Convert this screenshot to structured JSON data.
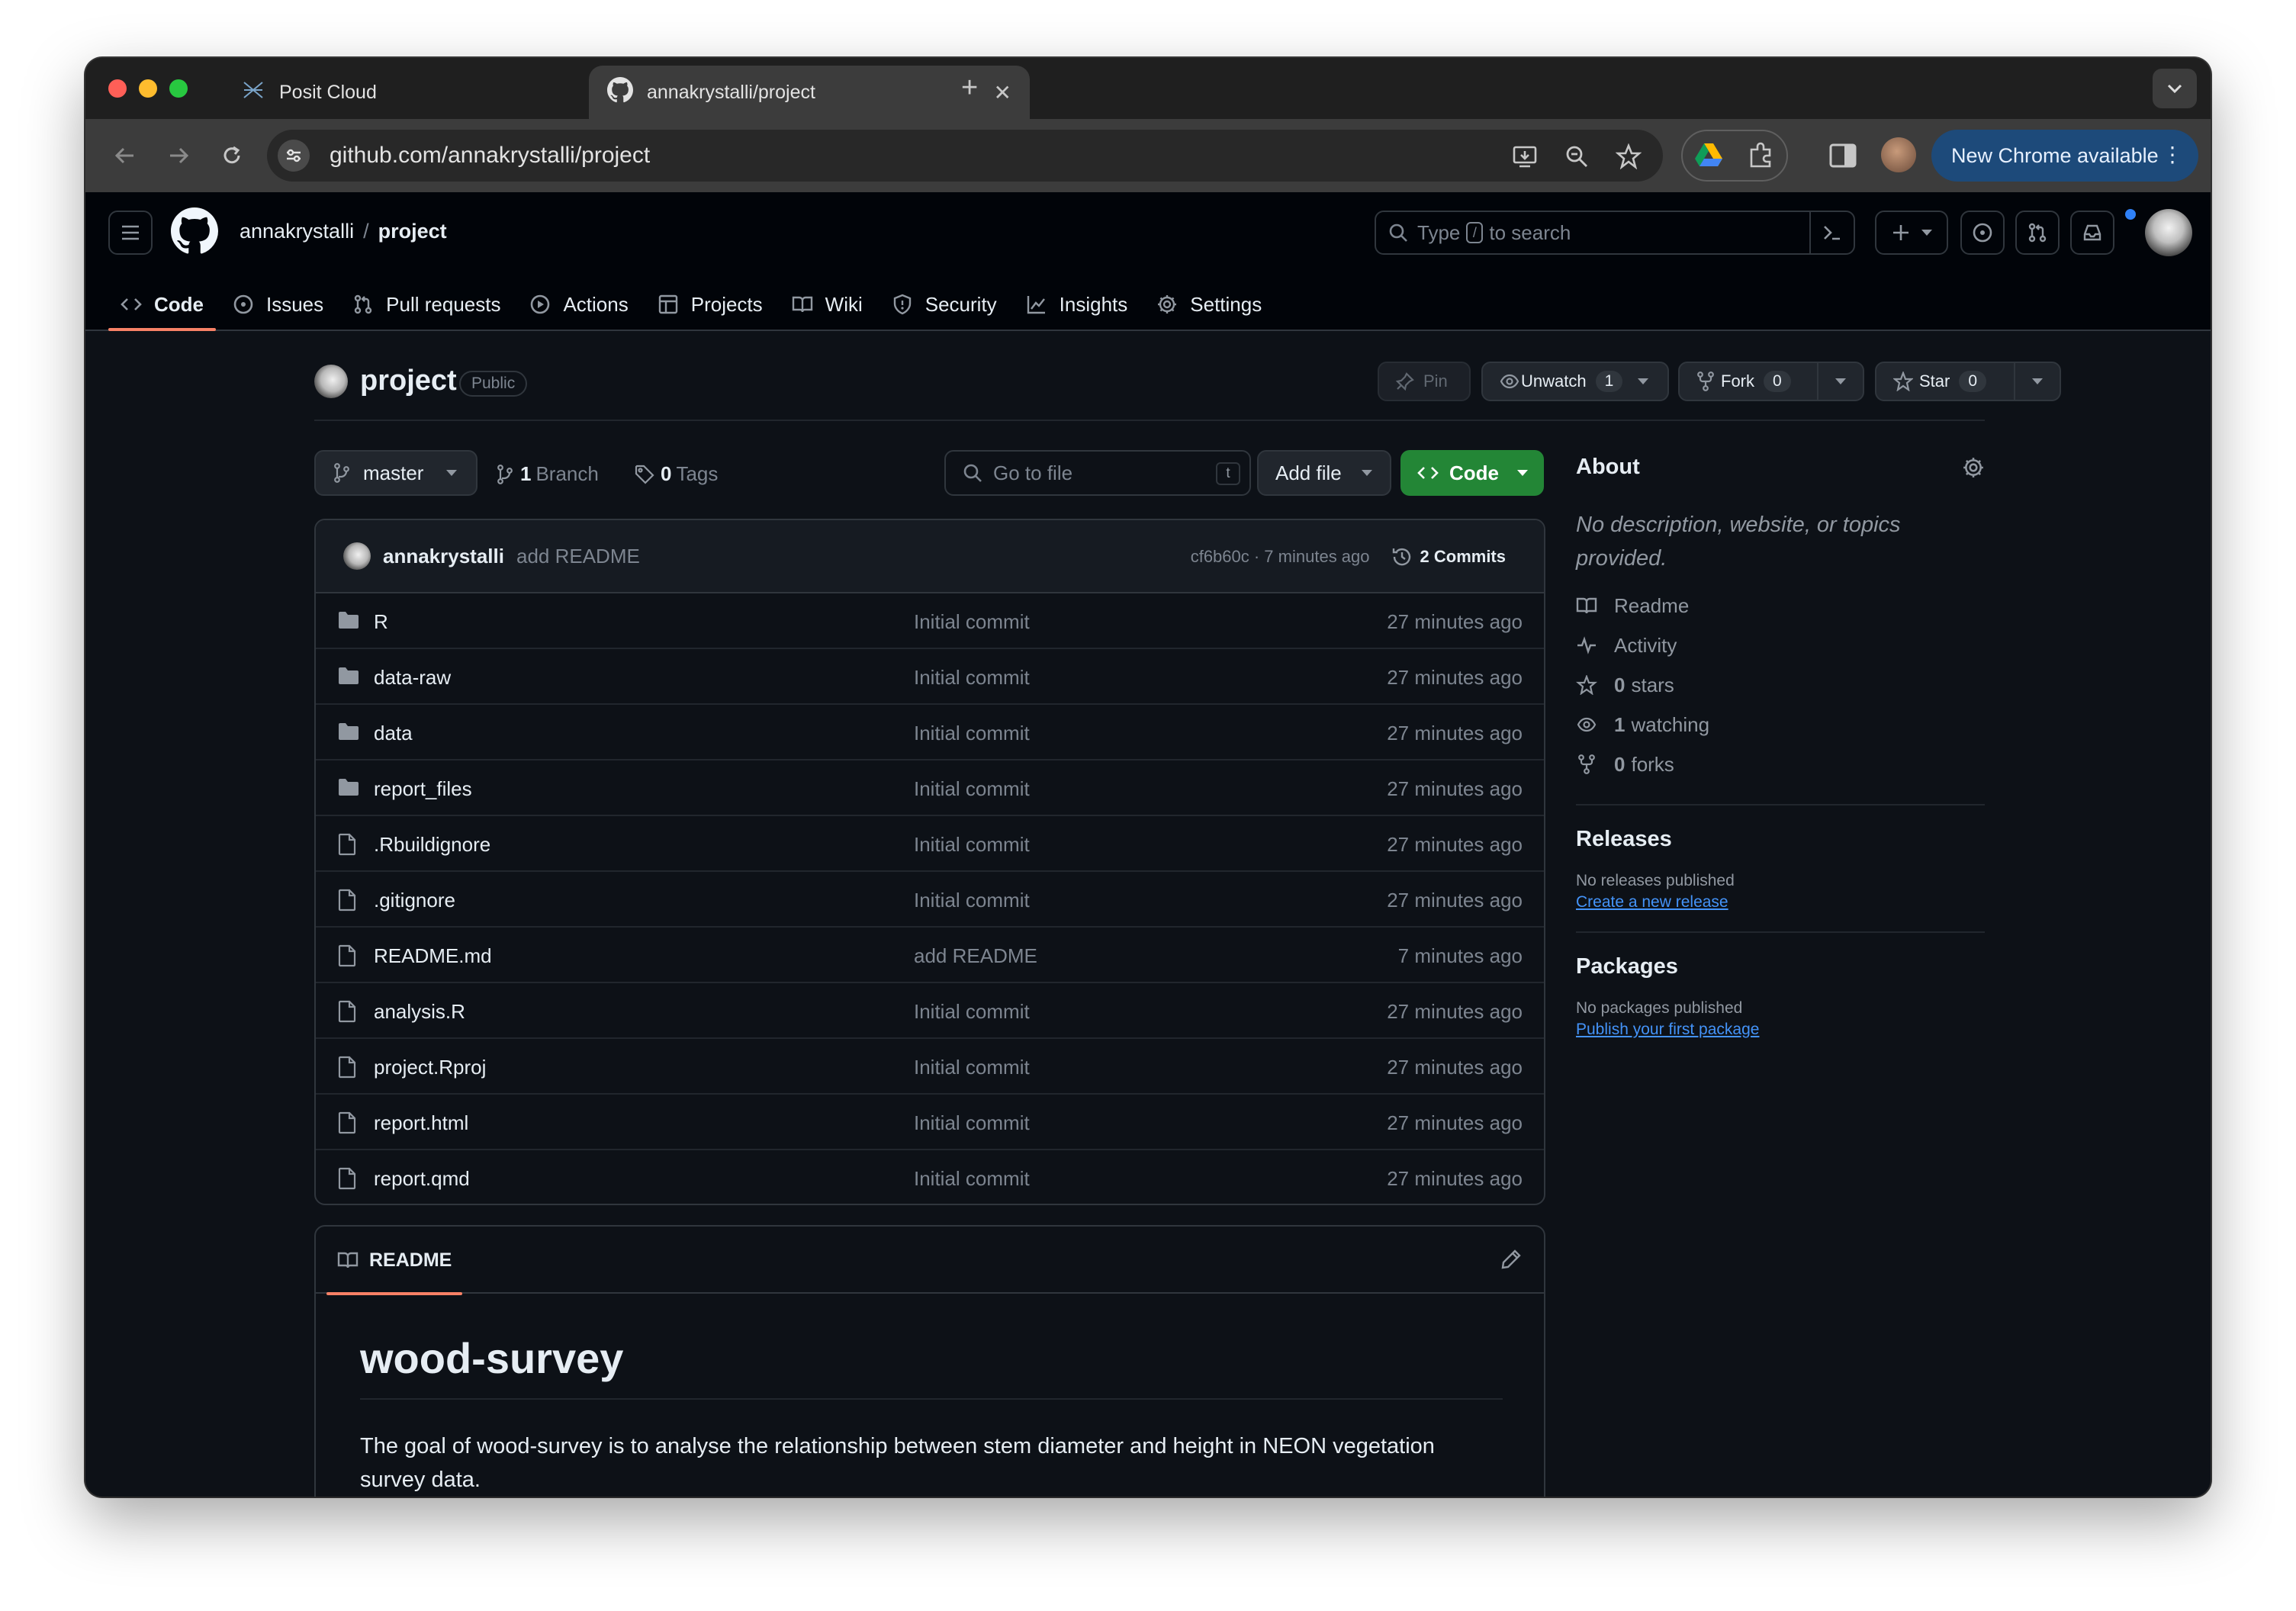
{
  "browser": {
    "tabs": [
      {
        "title": "Posit Cloud",
        "active": false
      },
      {
        "title": "annakrystalli/project",
        "active": true
      }
    ],
    "new_tab_symbol": "+",
    "url": "github.com/annakrystalli/project",
    "update_label": "New Chrome available",
    "traffic_colors": [
      "#ff5f57",
      "#febc2e",
      "#28c840"
    ]
  },
  "header": {
    "owner": "annakrystalli",
    "separator": "/",
    "repo": "project",
    "search": {
      "prefix": "Type",
      "key": "/",
      "suffix": "to search"
    }
  },
  "repo_nav": [
    {
      "label": "Code",
      "icon": "code-icon",
      "active": true
    },
    {
      "label": "Issues",
      "icon": "issue-icon",
      "active": false
    },
    {
      "label": "Pull requests",
      "icon": "pull-request-icon",
      "active": false
    },
    {
      "label": "Actions",
      "icon": "play-icon",
      "active": false
    },
    {
      "label": "Projects",
      "icon": "table-icon",
      "active": false
    },
    {
      "label": "Wiki",
      "icon": "book-icon",
      "active": false
    },
    {
      "label": "Security",
      "icon": "shield-icon",
      "active": false
    },
    {
      "label": "Insights",
      "icon": "graph-icon",
      "active": false
    },
    {
      "label": "Settings",
      "icon": "gear-icon",
      "active": false
    }
  ],
  "repo": {
    "name": "project",
    "visibility": "Public",
    "pin_label": "Pin",
    "unwatch_label": "Unwatch",
    "watch_count": "1",
    "fork_label": "Fork",
    "fork_count": "0",
    "star_label": "Star",
    "star_count": "0"
  },
  "branch": {
    "current": "master",
    "branch_count": "1",
    "branch_label": "Branch",
    "tag_count": "0",
    "tag_label": "Tags",
    "goto_placeholder": "Go to file",
    "goto_key": "t",
    "add_file_label": "Add file",
    "code_label": "Code"
  },
  "latest_commit": {
    "author": "annakrystalli",
    "message": "add README",
    "meta": "cf6b60c · 7 minutes ago",
    "commits_label": "2 Commits"
  },
  "files": [
    {
      "name": "R",
      "type": "folder",
      "commit": "Initial commit",
      "date": "27 minutes ago"
    },
    {
      "name": "data-raw",
      "type": "folder",
      "commit": "Initial commit",
      "date": "27 minutes ago"
    },
    {
      "name": "data",
      "type": "folder",
      "commit": "Initial commit",
      "date": "27 minutes ago"
    },
    {
      "name": "report_files",
      "type": "folder",
      "commit": "Initial commit",
      "date": "27 minutes ago"
    },
    {
      "name": ".Rbuildignore",
      "type": "file",
      "commit": "Initial commit",
      "date": "27 minutes ago"
    },
    {
      "name": ".gitignore",
      "type": "file",
      "commit": "Initial commit",
      "date": "27 minutes ago"
    },
    {
      "name": "README.md",
      "type": "file",
      "commit": "add README",
      "date": "7 minutes ago"
    },
    {
      "name": "analysis.R",
      "type": "file",
      "commit": "Initial commit",
      "date": "27 minutes ago"
    },
    {
      "name": "project.Rproj",
      "type": "file",
      "commit": "Initial commit",
      "date": "27 minutes ago"
    },
    {
      "name": "report.html",
      "type": "file",
      "commit": "Initial commit",
      "date": "27 minutes ago"
    },
    {
      "name": "report.qmd",
      "type": "file",
      "commit": "Initial commit",
      "date": "27 minutes ago"
    }
  ],
  "readme": {
    "tab_label": "README",
    "heading": "wood-survey",
    "paragraph": "The goal of wood-survey is to analyse the relationship between stem diameter and height in NEON vegetation survey data."
  },
  "about": {
    "title": "About",
    "description": "No description, website, or topics provided.",
    "readme_label": "Readme",
    "activity_label": "Activity",
    "stars_count": "0",
    "stars_label": "stars",
    "watching_count": "1",
    "watching_label": "watching",
    "forks_count": "0",
    "forks_label": "forks"
  },
  "releases": {
    "title": "Releases",
    "empty_text": "No releases published",
    "link": "Create a new release"
  },
  "packages": {
    "title": "Packages",
    "empty_text": "No packages published",
    "link": "Publish your first package"
  },
  "colors": {
    "bg": "#0d1117",
    "header_bg": "#010409",
    "border": "#30363d",
    "accent_underline": "#f78166",
    "primary_button": "#238636",
    "link": "#4493f8"
  }
}
